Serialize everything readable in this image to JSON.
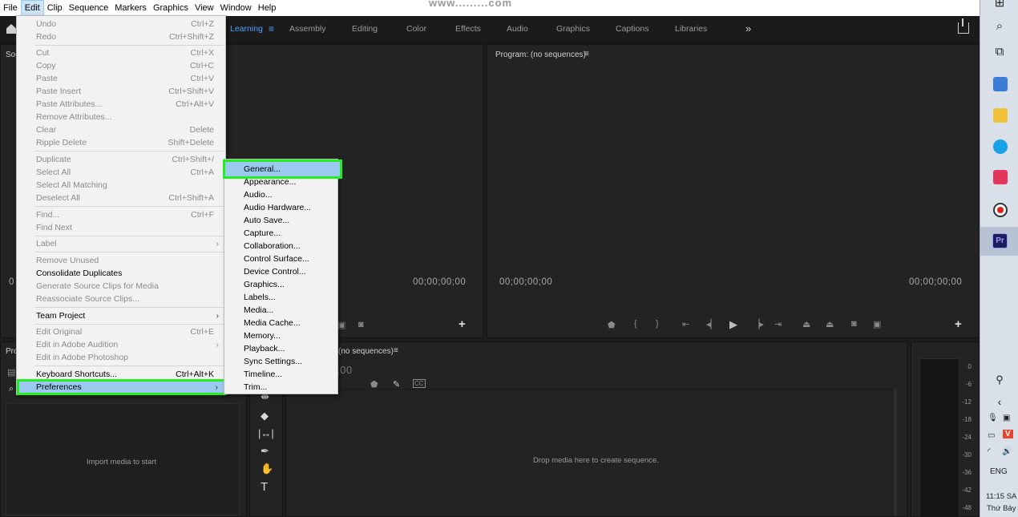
{
  "menubar": {
    "items": [
      "File",
      "Edit",
      "Clip",
      "Sequence",
      "Markers",
      "Graphics",
      "View",
      "Window",
      "Help"
    ],
    "watermark": "www.........com"
  },
  "workspaces": {
    "tabs": [
      "Learning",
      "Assembly",
      "Editing",
      "Color",
      "Effects",
      "Audio",
      "Graphics",
      "Captions",
      "Libraries"
    ],
    "active": "Learning",
    "more": "»"
  },
  "source_panel": {
    "title": "Sou",
    "timecode_left": "0",
    "timecode_right": "00;00;00;00"
  },
  "program_panel": {
    "title": "Program: (no sequences)",
    "timecode_left": "00;00;00;00",
    "timecode_right": "00;00;00;00"
  },
  "project_panel": {
    "title": "Pro",
    "import_hint": "Import media to start"
  },
  "timeline_panel": {
    "title": "(no sequences)",
    "timecode": ";00",
    "drop_hint": "Drop media here to create sequence."
  },
  "meter": {
    "labels": [
      "0",
      "-6",
      "-12",
      "-18",
      "-24",
      "-30",
      "-36",
      "-42",
      "-48"
    ]
  },
  "edit_menu": {
    "items": [
      {
        "label": "Undo",
        "shortcut": "Ctrl+Z",
        "enabled": false
      },
      {
        "label": "Redo",
        "shortcut": "Ctrl+Shift+Z",
        "enabled": false
      },
      {
        "label": "Cut",
        "shortcut": "Ctrl+X",
        "enabled": false
      },
      {
        "label": "Copy",
        "shortcut": "Ctrl+C",
        "enabled": false
      },
      {
        "label": "Paste",
        "shortcut": "Ctrl+V",
        "enabled": false
      },
      {
        "label": "Paste Insert",
        "shortcut": "Ctrl+Shift+V",
        "enabled": false
      },
      {
        "label": "Paste Attributes...",
        "shortcut": "Ctrl+Alt+V",
        "enabled": false
      },
      {
        "label": "Remove Attributes...",
        "shortcut": "",
        "enabled": false
      },
      {
        "label": "Clear",
        "shortcut": "Delete",
        "enabled": false
      },
      {
        "label": "Ripple Delete",
        "shortcut": "Shift+Delete",
        "enabled": false
      },
      {
        "label": "Duplicate",
        "shortcut": "Ctrl+Shift+/",
        "enabled": false
      },
      {
        "label": "Select All",
        "shortcut": "Ctrl+A",
        "enabled": false
      },
      {
        "label": "Select All Matching",
        "shortcut": "",
        "enabled": false
      },
      {
        "label": "Deselect All",
        "shortcut": "Ctrl+Shift+A",
        "enabled": false
      },
      {
        "label": "Find...",
        "shortcut": "Ctrl+F",
        "enabled": false
      },
      {
        "label": "Find Next",
        "shortcut": "",
        "enabled": false
      },
      {
        "label": "Label",
        "shortcut": "",
        "enabled": false
      },
      {
        "label": "Remove Unused",
        "shortcut": "",
        "enabled": false
      },
      {
        "label": "Consolidate Duplicates",
        "shortcut": "",
        "enabled": true
      },
      {
        "label": "Generate Source Clips for Media",
        "shortcut": "",
        "enabled": false
      },
      {
        "label": "Reassociate Source Clips...",
        "shortcut": "",
        "enabled": false
      },
      {
        "label": "Team Project",
        "shortcut": "",
        "enabled": true
      },
      {
        "label": "Edit Original",
        "shortcut": "Ctrl+E",
        "enabled": false
      },
      {
        "label": "Edit in Adobe Audition",
        "shortcut": "",
        "enabled": false
      },
      {
        "label": "Edit in Adobe Photoshop",
        "shortcut": "",
        "enabled": false
      },
      {
        "label": "Keyboard Shortcuts...",
        "shortcut": "Ctrl+Alt+K",
        "enabled": true
      },
      {
        "label": "Preferences",
        "shortcut": "",
        "enabled": true
      }
    ],
    "submenu_arrow": "›"
  },
  "preferences_menu": {
    "items": [
      "General...",
      "Appearance...",
      "Audio...",
      "Audio Hardware...",
      "Auto Save...",
      "Capture...",
      "Collaboration...",
      "Control Surface...",
      "Device Control...",
      "Graphics...",
      "Labels...",
      "Media...",
      "Media Cache...",
      "Memory...",
      "Playback...",
      "Sync Settings...",
      "Timeline...",
      "Trim..."
    ]
  },
  "taskbar": {
    "language": "ENG",
    "time": "11:15 SA",
    "day": "Thứ Bảy",
    "premiere_label": "Pr",
    "v_label": "V"
  }
}
